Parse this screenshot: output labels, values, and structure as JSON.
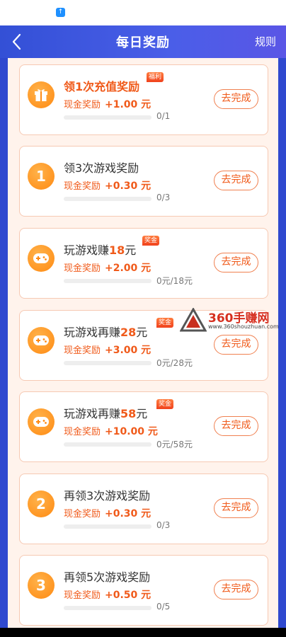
{
  "header": {
    "title": "每日奖励",
    "rules_label": "规则",
    "back_icon": "chevron-left-icon"
  },
  "colors": {
    "accent": "#f05a1a",
    "header_bg": "#3350d6",
    "content_bg": "#fff3ec"
  },
  "tasks": [
    {
      "icon": "gift-icon",
      "title": "领1次充值奖励",
      "highlight": "",
      "badge": "福利",
      "reward_label": "现金奖励",
      "reward_amount": "+1.00 元",
      "progress_text": "0/1",
      "progress": 0,
      "button_label": "去完成"
    },
    {
      "icon": "number-1-icon",
      "icon_text": "1",
      "title": "领3次游戏奖励",
      "highlight": "",
      "badge": "",
      "reward_label": "现金奖励",
      "reward_amount": "+0.30 元",
      "progress_text": "0/3",
      "progress": 0,
      "button_label": "去完成"
    },
    {
      "icon": "gamepad-icon",
      "title": "玩游戏赚",
      "highlight": "18",
      "title_suffix": "元",
      "badge": "奖金",
      "reward_label": "现金奖励",
      "reward_amount": "+2.00 元",
      "progress_text": "0元/18元",
      "progress": 0,
      "button_label": "去完成"
    },
    {
      "icon": "gamepad-icon",
      "title": "玩游戏再赚",
      "highlight": "28",
      "title_suffix": "元",
      "badge": "奖金",
      "reward_label": "现金奖励",
      "reward_amount": "+3.00 元",
      "progress_text": "0元/28元",
      "progress": 0,
      "button_label": "去完成"
    },
    {
      "icon": "gamepad-icon",
      "title": "玩游戏再赚",
      "highlight": "58",
      "title_suffix": "元",
      "badge": "奖金",
      "reward_label": "现金奖励",
      "reward_amount": "+10.00 元",
      "progress_text": "0元/58元",
      "progress": 0,
      "button_label": "去完成"
    },
    {
      "icon": "number-2-icon",
      "icon_text": "2",
      "title": "再领3次游戏奖励",
      "highlight": "",
      "badge": "",
      "reward_label": "现金奖励",
      "reward_amount": "+0.30 元",
      "progress_text": "0/3",
      "progress": 0,
      "button_label": "去完成"
    },
    {
      "icon": "number-3-icon",
      "icon_text": "3",
      "title": "再领5次游戏奖励",
      "highlight": "",
      "badge": "",
      "reward_label": "现金奖励",
      "reward_amount": "+0.50 元",
      "progress_text": "0/5",
      "progress": 0,
      "button_label": "去完成"
    }
  ],
  "watermark": {
    "name": "360手赚网",
    "url": "www.360shouzhuan.com"
  }
}
